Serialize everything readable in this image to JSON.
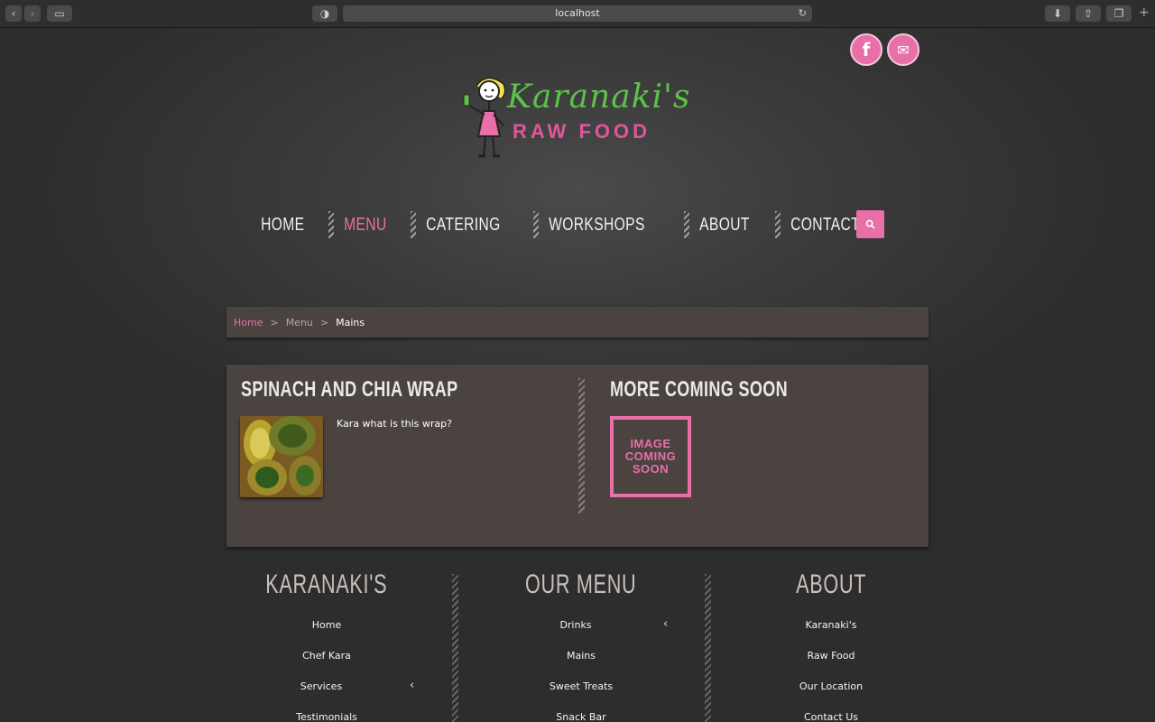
{
  "browser": {
    "url": "localhost"
  },
  "social": {
    "facebook": "f",
    "email": "✉"
  },
  "logo": {
    "title": "Karanaki's",
    "subtitle": "RAW FOOD"
  },
  "nav": {
    "items": [
      {
        "label": "HOME"
      },
      {
        "label": "MENU"
      },
      {
        "label": "CATERING"
      },
      {
        "label": "WORKSHOPS"
      },
      {
        "label": "ABOUT"
      },
      {
        "label": "CONTACT"
      }
    ],
    "active": "MENU"
  },
  "breadcrumb": {
    "home": "Home",
    "menu": "Menu",
    "current": "Mains",
    "sep": ">"
  },
  "panel": {
    "left": {
      "title": "SPINACH AND CHIA WRAP",
      "description": "Kara what is this wrap?"
    },
    "right": {
      "title": "MORE COMING SOON",
      "placeholder": "IMAGE COMING SOON"
    }
  },
  "footer": {
    "col1": {
      "title": "KARANAKI'S",
      "items": [
        "Home",
        "Chef Kara",
        "Services",
        "Testimonials"
      ]
    },
    "col2": {
      "title": "OUR MENU",
      "items": [
        "Drinks",
        "Mains",
        "Sweet Treats",
        "Snack Bar"
      ]
    },
    "col3": {
      "title": "ABOUT",
      "items": [
        "Karanaki's",
        "Raw Food",
        "Our Location",
        "Contact Us"
      ]
    }
  },
  "colors": {
    "accent": "#e96fa8",
    "logo_green": "#5dc24a",
    "panel": "#4a4340"
  }
}
